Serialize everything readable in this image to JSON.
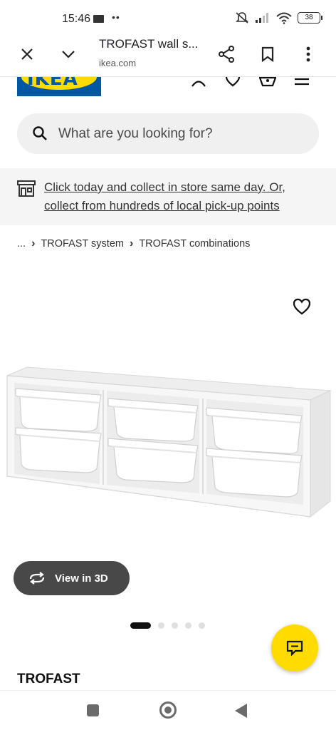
{
  "status_bar": {
    "time": "15:46",
    "battery": "38",
    "icons": [
      "mail-icon",
      "mute-icon",
      "signal-icon",
      "wifi-icon",
      "battery-icon"
    ]
  },
  "browser": {
    "page_title": "TROFAST wall s...",
    "url": "ikea.com",
    "icons": [
      "close-icon",
      "chevron-down-icon",
      "share-icon",
      "bookmark-icon",
      "more-vert-icon"
    ]
  },
  "header": {
    "logo_text": "IKEA",
    "icons": [
      "user-icon",
      "heart-icon",
      "basket-icon",
      "menu-icon"
    ]
  },
  "search": {
    "placeholder": "What are you looking for?"
  },
  "banner": {
    "text": "Click today and collect in store same day. Or, collect from hundreds of local pick-up points"
  },
  "breadcrumb": {
    "ellipsis": "...",
    "items": [
      "TROFAST system",
      "TROFAST combinations"
    ]
  },
  "product": {
    "name": "TROFAST",
    "view_3d_label": "View in 3D",
    "image_count": 5,
    "active_image": 1
  },
  "colors": {
    "ikea_blue": "#0058a3",
    "ikea_yellow": "#ffdb00",
    "button_dark": "#484848",
    "banner_bg": "#f5f5f5",
    "search_bg": "#f0f0f0"
  }
}
